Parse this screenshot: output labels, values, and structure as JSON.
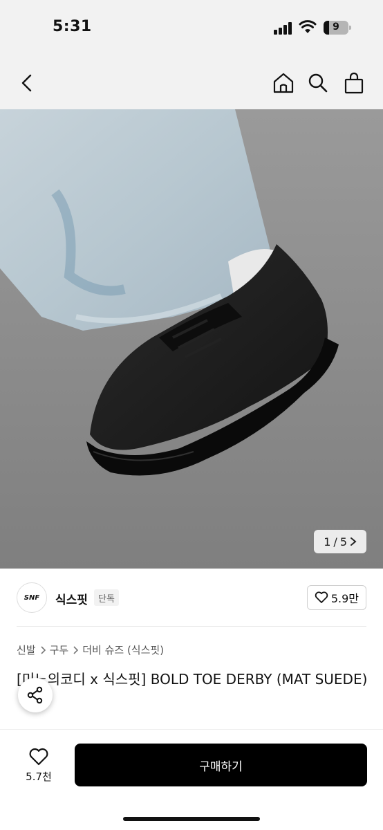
{
  "status_bar": {
    "time": "5:31",
    "battery": "9"
  },
  "nav": {
    "back_icon": "chevron-left-icon",
    "home_icon": "home-icon",
    "search_icon": "search-icon",
    "bag_icon": "shopping-bag-icon"
  },
  "gallery": {
    "current": "1",
    "separator": "/",
    "total": "5"
  },
  "seller": {
    "logo_text": "SNF",
    "name": "식스핏",
    "badge": "단독",
    "likes": "5.9만"
  },
  "breadcrumb": [
    "신발",
    "구두",
    "더비 슈즈 (식스핏)"
  ],
  "product": {
    "title": "[미노의코디 x 식스핏] BOLD TOE DERBY (MAT SUEDE)"
  },
  "bottom": {
    "like_count": "5.7천",
    "buy_label": "구매하기"
  },
  "colors": {
    "primary": "#000000",
    "background": "#ffffff",
    "header_bg": "#f2f2f2"
  }
}
